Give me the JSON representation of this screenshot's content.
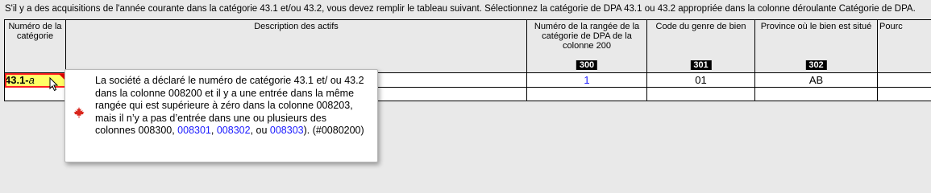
{
  "instruction": "S'il y a des acquisitions de l'année courante dans la catégorie 43.1 et/ou 43.2, vous devez remplir le tableau suivant. Sélectionnez la catégorie de DPA 43.1 ou 43.2 appropriée dans la colonne déroulante Catégorie de DPA.",
  "table": {
    "headers": [
      {
        "label": "Numéro de la catégorie",
        "code": ""
      },
      {
        "label": "Description des actifs",
        "code": ""
      },
      {
        "label": "Numéro de la rangée de la catégorie de DPA de la colonne 200",
        "code": "300"
      },
      {
        "label": "Code du genre de bien",
        "code": "301"
      },
      {
        "label": "Province où le bien est situé",
        "code": "302"
      },
      {
        "label": "Pourc",
        "code": ""
      }
    ],
    "row1": {
      "category": "43.1-",
      "category_suffix": "a",
      "description": "",
      "row_number": "1",
      "property_code": "01",
      "province": "AB",
      "percent": ""
    }
  },
  "tooltip": {
    "text_main": "La société a déclaré le numéro de catégorie 43.1 et/ ou 43.2 dans la colonne 008200 et il y a une entrée dans la même rangée qui est supérieure à zéro dans la colonne 008203, mais il n’y a pas d’entrée dans une ou plusieurs des colonnes 008300, ",
    "link1": "008301",
    "sep1": ", ",
    "link2": "008302",
    "sep2": ", ou ",
    "link3": "008303",
    "text_end": "). (#0080200)",
    "icon": "maple-leaf-icon"
  },
  "colors": {
    "background": "#e9e9e9",
    "error_cell": "#ffff66",
    "error_outline": "#ff2020",
    "link": "#1a1aff",
    "leaf": "#d9241b"
  }
}
